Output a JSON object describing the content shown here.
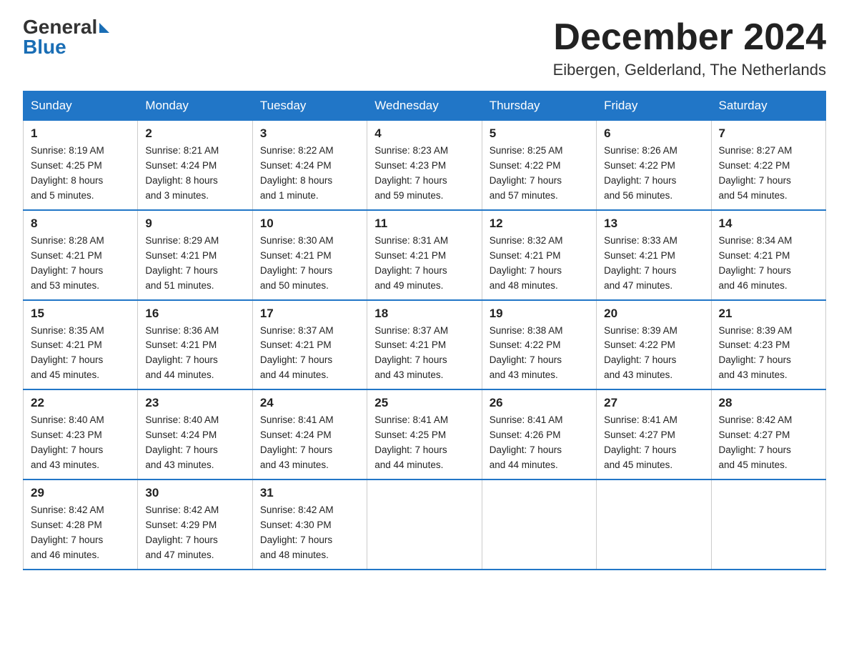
{
  "logo": {
    "general": "General",
    "blue": "Blue"
  },
  "title": "December 2024",
  "subtitle": "Eibergen, Gelderland, The Netherlands",
  "days_of_week": [
    "Sunday",
    "Monday",
    "Tuesday",
    "Wednesday",
    "Thursday",
    "Friday",
    "Saturday"
  ],
  "weeks": [
    [
      {
        "day": "1",
        "sunrise": "8:19 AM",
        "sunset": "4:25 PM",
        "daylight": "8 hours and 5 minutes."
      },
      {
        "day": "2",
        "sunrise": "8:21 AM",
        "sunset": "4:24 PM",
        "daylight": "8 hours and 3 minutes."
      },
      {
        "day": "3",
        "sunrise": "8:22 AM",
        "sunset": "4:24 PM",
        "daylight": "8 hours and 1 minute."
      },
      {
        "day": "4",
        "sunrise": "8:23 AM",
        "sunset": "4:23 PM",
        "daylight": "7 hours and 59 minutes."
      },
      {
        "day": "5",
        "sunrise": "8:25 AM",
        "sunset": "4:22 PM",
        "daylight": "7 hours and 57 minutes."
      },
      {
        "day": "6",
        "sunrise": "8:26 AM",
        "sunset": "4:22 PM",
        "daylight": "7 hours and 56 minutes."
      },
      {
        "day": "7",
        "sunrise": "8:27 AM",
        "sunset": "4:22 PM",
        "daylight": "7 hours and 54 minutes."
      }
    ],
    [
      {
        "day": "8",
        "sunrise": "8:28 AM",
        "sunset": "4:21 PM",
        "daylight": "7 hours and 53 minutes."
      },
      {
        "day": "9",
        "sunrise": "8:29 AM",
        "sunset": "4:21 PM",
        "daylight": "7 hours and 51 minutes."
      },
      {
        "day": "10",
        "sunrise": "8:30 AM",
        "sunset": "4:21 PM",
        "daylight": "7 hours and 50 minutes."
      },
      {
        "day": "11",
        "sunrise": "8:31 AM",
        "sunset": "4:21 PM",
        "daylight": "7 hours and 49 minutes."
      },
      {
        "day": "12",
        "sunrise": "8:32 AM",
        "sunset": "4:21 PM",
        "daylight": "7 hours and 48 minutes."
      },
      {
        "day": "13",
        "sunrise": "8:33 AM",
        "sunset": "4:21 PM",
        "daylight": "7 hours and 47 minutes."
      },
      {
        "day": "14",
        "sunrise": "8:34 AM",
        "sunset": "4:21 PM",
        "daylight": "7 hours and 46 minutes."
      }
    ],
    [
      {
        "day": "15",
        "sunrise": "8:35 AM",
        "sunset": "4:21 PM",
        "daylight": "7 hours and 45 minutes."
      },
      {
        "day": "16",
        "sunrise": "8:36 AM",
        "sunset": "4:21 PM",
        "daylight": "7 hours and 44 minutes."
      },
      {
        "day": "17",
        "sunrise": "8:37 AM",
        "sunset": "4:21 PM",
        "daylight": "7 hours and 44 minutes."
      },
      {
        "day": "18",
        "sunrise": "8:37 AM",
        "sunset": "4:21 PM",
        "daylight": "7 hours and 43 minutes."
      },
      {
        "day": "19",
        "sunrise": "8:38 AM",
        "sunset": "4:22 PM",
        "daylight": "7 hours and 43 minutes."
      },
      {
        "day": "20",
        "sunrise": "8:39 AM",
        "sunset": "4:22 PM",
        "daylight": "7 hours and 43 minutes."
      },
      {
        "day": "21",
        "sunrise": "8:39 AM",
        "sunset": "4:23 PM",
        "daylight": "7 hours and 43 minutes."
      }
    ],
    [
      {
        "day": "22",
        "sunrise": "8:40 AM",
        "sunset": "4:23 PM",
        "daylight": "7 hours and 43 minutes."
      },
      {
        "day": "23",
        "sunrise": "8:40 AM",
        "sunset": "4:24 PM",
        "daylight": "7 hours and 43 minutes."
      },
      {
        "day": "24",
        "sunrise": "8:41 AM",
        "sunset": "4:24 PM",
        "daylight": "7 hours and 43 minutes."
      },
      {
        "day": "25",
        "sunrise": "8:41 AM",
        "sunset": "4:25 PM",
        "daylight": "7 hours and 44 minutes."
      },
      {
        "day": "26",
        "sunrise": "8:41 AM",
        "sunset": "4:26 PM",
        "daylight": "7 hours and 44 minutes."
      },
      {
        "day": "27",
        "sunrise": "8:41 AM",
        "sunset": "4:27 PM",
        "daylight": "7 hours and 45 minutes."
      },
      {
        "day": "28",
        "sunrise": "8:42 AM",
        "sunset": "4:27 PM",
        "daylight": "7 hours and 45 minutes."
      }
    ],
    [
      {
        "day": "29",
        "sunrise": "8:42 AM",
        "sunset": "4:28 PM",
        "daylight": "7 hours and 46 minutes."
      },
      {
        "day": "30",
        "sunrise": "8:42 AM",
        "sunset": "4:29 PM",
        "daylight": "7 hours and 47 minutes."
      },
      {
        "day": "31",
        "sunrise": "8:42 AM",
        "sunset": "4:30 PM",
        "daylight": "7 hours and 48 minutes."
      },
      null,
      null,
      null,
      null
    ]
  ],
  "labels": {
    "sunrise": "Sunrise:",
    "sunset": "Sunset:",
    "daylight": "Daylight:"
  }
}
